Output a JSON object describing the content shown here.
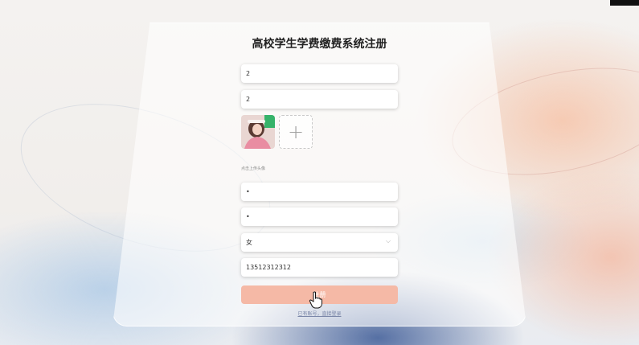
{
  "page": {
    "title": "高校学生学费缴费系统注册"
  },
  "form": {
    "field_1_value": "2",
    "field_2_value": "2",
    "upload_hint": "点击上传头像",
    "field_3_value": "•",
    "field_4_value": "•",
    "gender_value": "女",
    "phone_value": "13512312312",
    "submit_label": "注册",
    "login_link": "已有账号，直接登录"
  },
  "icons": {
    "select_arrow": "chevron-down-icon",
    "upload_plus": "plus-icon",
    "cursor": "hand-pointer-icon"
  },
  "colors": {
    "submit_bg": "#f5b9a6",
    "accent_peach": "#f7bea0",
    "accent_blue": "#3c5a96"
  }
}
